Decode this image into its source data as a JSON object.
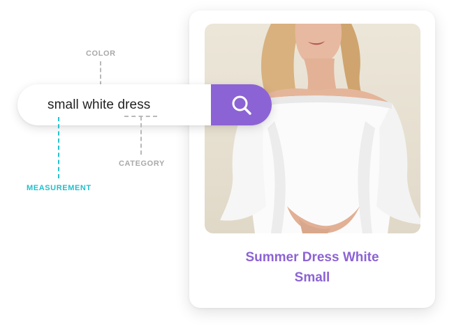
{
  "search": {
    "query": "small white dress",
    "button_icon": "search-icon"
  },
  "annotations": {
    "color_label": "COLOR",
    "category_label": "CATEGORY",
    "measurement_label": "MEASUREMENT"
  },
  "product": {
    "title_line1": "Summer Dress White",
    "title_line2": "Small"
  },
  "colors": {
    "accent": "#8c63d4",
    "measurement": "#20bfcc",
    "annotation_gray": "#a9a9a9"
  }
}
